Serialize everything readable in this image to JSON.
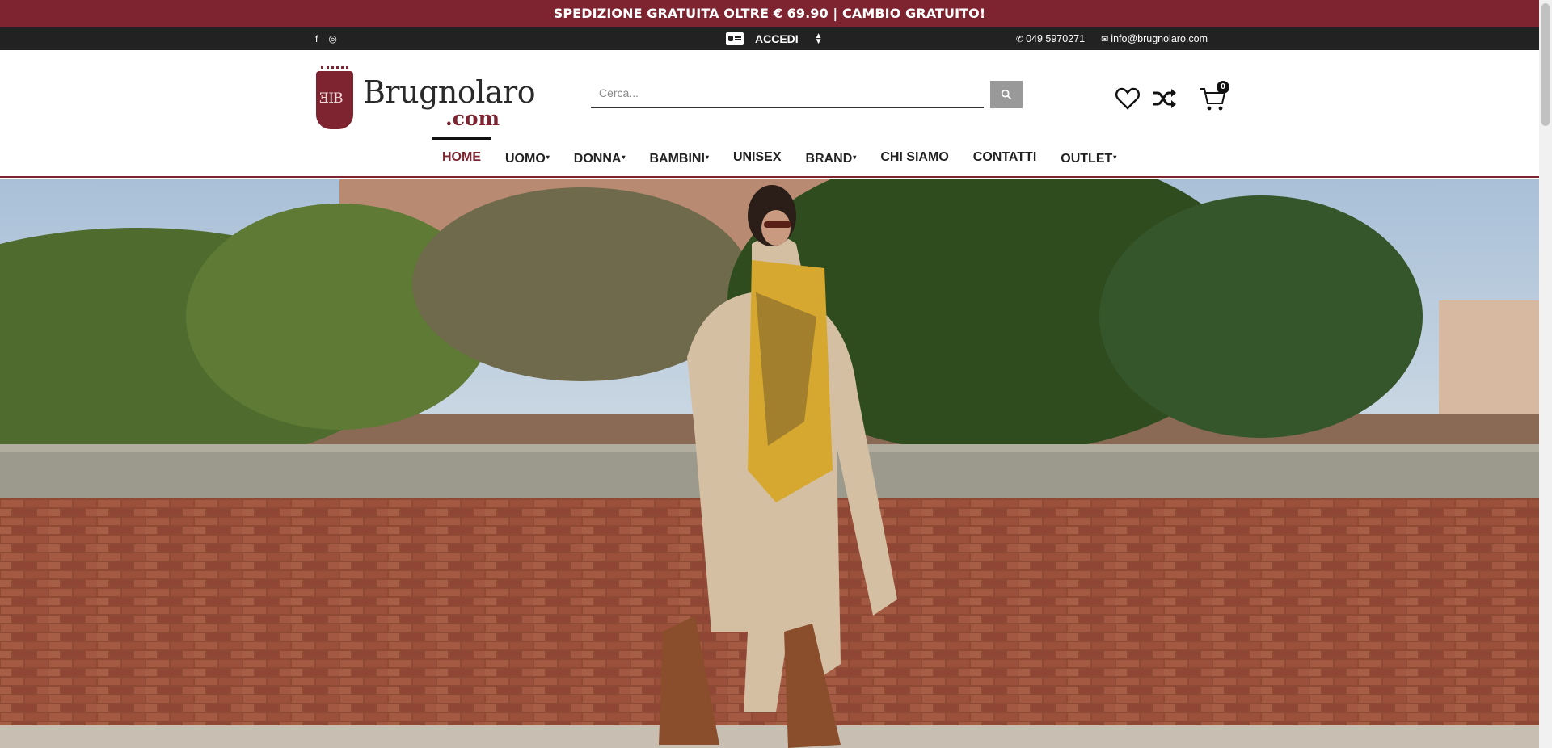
{
  "promo": {
    "text": "SPEDIZIONE GRATUITA OLTRE € 69.90 | CAMBIO GRATUITO!"
  },
  "topbar": {
    "social": [
      {
        "icon": "facebook-icon",
        "glyph": "f"
      },
      {
        "icon": "instagram-icon",
        "glyph": "◎"
      }
    ],
    "login_label": "ACCEDI",
    "phone": "049 5970271",
    "email": "info@brugnolaro.com"
  },
  "logo": {
    "name": "Brugnolaro",
    "suffix": ".com"
  },
  "search": {
    "placeholder": "Cerca..."
  },
  "cart": {
    "count": "0"
  },
  "nav": [
    {
      "label": "HOME",
      "active": true,
      "dropdown": false
    },
    {
      "label": "UOMO",
      "dropdown": true
    },
    {
      "label": "DONNA",
      "dropdown": true
    },
    {
      "label": "BAMBINI",
      "dropdown": true
    },
    {
      "label": "UNISEX",
      "dropdown": false
    },
    {
      "label": "BRAND",
      "dropdown": true
    },
    {
      "label": "CHI SIAMO",
      "dropdown": false
    },
    {
      "label": "CONTATTI",
      "dropdown": false
    },
    {
      "label": "OUTLET",
      "dropdown": true
    }
  ],
  "colors": {
    "brand": "#7d2430",
    "topbar": "#222222"
  }
}
